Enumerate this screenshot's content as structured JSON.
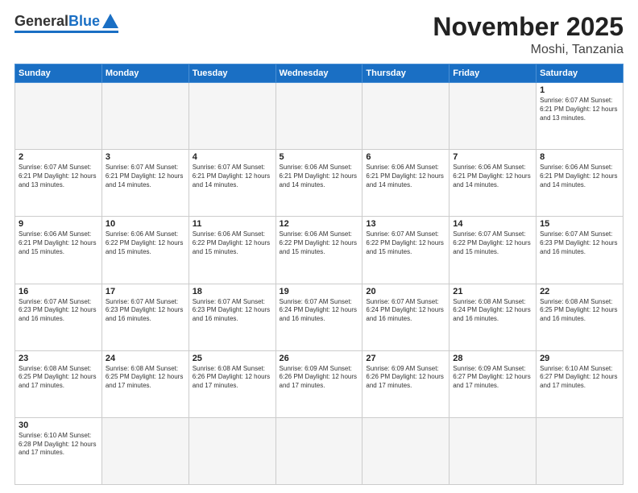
{
  "logo": {
    "general": "General",
    "blue": "Blue"
  },
  "header": {
    "month": "November 2025",
    "location": "Moshi, Tanzania"
  },
  "weekdays": [
    "Sunday",
    "Monday",
    "Tuesday",
    "Wednesday",
    "Thursday",
    "Friday",
    "Saturday"
  ],
  "weeks": [
    [
      {
        "day": "",
        "info": ""
      },
      {
        "day": "",
        "info": ""
      },
      {
        "day": "",
        "info": ""
      },
      {
        "day": "",
        "info": ""
      },
      {
        "day": "",
        "info": ""
      },
      {
        "day": "",
        "info": ""
      },
      {
        "day": "1",
        "info": "Sunrise: 6:07 AM\nSunset: 6:21 PM\nDaylight: 12 hours and 13 minutes."
      }
    ],
    [
      {
        "day": "2",
        "info": "Sunrise: 6:07 AM\nSunset: 6:21 PM\nDaylight: 12 hours and 13 minutes."
      },
      {
        "day": "3",
        "info": "Sunrise: 6:07 AM\nSunset: 6:21 PM\nDaylight: 12 hours and 14 minutes."
      },
      {
        "day": "4",
        "info": "Sunrise: 6:07 AM\nSunset: 6:21 PM\nDaylight: 12 hours and 14 minutes."
      },
      {
        "day": "5",
        "info": "Sunrise: 6:06 AM\nSunset: 6:21 PM\nDaylight: 12 hours and 14 minutes."
      },
      {
        "day": "6",
        "info": "Sunrise: 6:06 AM\nSunset: 6:21 PM\nDaylight: 12 hours and 14 minutes."
      },
      {
        "day": "7",
        "info": "Sunrise: 6:06 AM\nSunset: 6:21 PM\nDaylight: 12 hours and 14 minutes."
      },
      {
        "day": "8",
        "info": "Sunrise: 6:06 AM\nSunset: 6:21 PM\nDaylight: 12 hours and 14 minutes."
      }
    ],
    [
      {
        "day": "9",
        "info": "Sunrise: 6:06 AM\nSunset: 6:21 PM\nDaylight: 12 hours and 15 minutes."
      },
      {
        "day": "10",
        "info": "Sunrise: 6:06 AM\nSunset: 6:22 PM\nDaylight: 12 hours and 15 minutes."
      },
      {
        "day": "11",
        "info": "Sunrise: 6:06 AM\nSunset: 6:22 PM\nDaylight: 12 hours and 15 minutes."
      },
      {
        "day": "12",
        "info": "Sunrise: 6:06 AM\nSunset: 6:22 PM\nDaylight: 12 hours and 15 minutes."
      },
      {
        "day": "13",
        "info": "Sunrise: 6:07 AM\nSunset: 6:22 PM\nDaylight: 12 hours and 15 minutes."
      },
      {
        "day": "14",
        "info": "Sunrise: 6:07 AM\nSunset: 6:22 PM\nDaylight: 12 hours and 15 minutes."
      },
      {
        "day": "15",
        "info": "Sunrise: 6:07 AM\nSunset: 6:23 PM\nDaylight: 12 hours and 16 minutes."
      }
    ],
    [
      {
        "day": "16",
        "info": "Sunrise: 6:07 AM\nSunset: 6:23 PM\nDaylight: 12 hours and 16 minutes."
      },
      {
        "day": "17",
        "info": "Sunrise: 6:07 AM\nSunset: 6:23 PM\nDaylight: 12 hours and 16 minutes."
      },
      {
        "day": "18",
        "info": "Sunrise: 6:07 AM\nSunset: 6:23 PM\nDaylight: 12 hours and 16 minutes."
      },
      {
        "day": "19",
        "info": "Sunrise: 6:07 AM\nSunset: 6:24 PM\nDaylight: 12 hours and 16 minutes."
      },
      {
        "day": "20",
        "info": "Sunrise: 6:07 AM\nSunset: 6:24 PM\nDaylight: 12 hours and 16 minutes."
      },
      {
        "day": "21",
        "info": "Sunrise: 6:08 AM\nSunset: 6:24 PM\nDaylight: 12 hours and 16 minutes."
      },
      {
        "day": "22",
        "info": "Sunrise: 6:08 AM\nSunset: 6:25 PM\nDaylight: 12 hours and 16 minutes."
      }
    ],
    [
      {
        "day": "23",
        "info": "Sunrise: 6:08 AM\nSunset: 6:25 PM\nDaylight: 12 hours and 17 minutes."
      },
      {
        "day": "24",
        "info": "Sunrise: 6:08 AM\nSunset: 6:25 PM\nDaylight: 12 hours and 17 minutes."
      },
      {
        "day": "25",
        "info": "Sunrise: 6:08 AM\nSunset: 6:26 PM\nDaylight: 12 hours and 17 minutes."
      },
      {
        "day": "26",
        "info": "Sunrise: 6:09 AM\nSunset: 6:26 PM\nDaylight: 12 hours and 17 minutes."
      },
      {
        "day": "27",
        "info": "Sunrise: 6:09 AM\nSunset: 6:26 PM\nDaylight: 12 hours and 17 minutes."
      },
      {
        "day": "28",
        "info": "Sunrise: 6:09 AM\nSunset: 6:27 PM\nDaylight: 12 hours and 17 minutes."
      },
      {
        "day": "29",
        "info": "Sunrise: 6:10 AM\nSunset: 6:27 PM\nDaylight: 12 hours and 17 minutes."
      }
    ],
    [
      {
        "day": "30",
        "info": "Sunrise: 6:10 AM\nSunset: 6:28 PM\nDaylight: 12 hours and 17 minutes."
      },
      {
        "day": "",
        "info": ""
      },
      {
        "day": "",
        "info": ""
      },
      {
        "day": "",
        "info": ""
      },
      {
        "day": "",
        "info": ""
      },
      {
        "day": "",
        "info": ""
      },
      {
        "day": "",
        "info": ""
      }
    ]
  ]
}
